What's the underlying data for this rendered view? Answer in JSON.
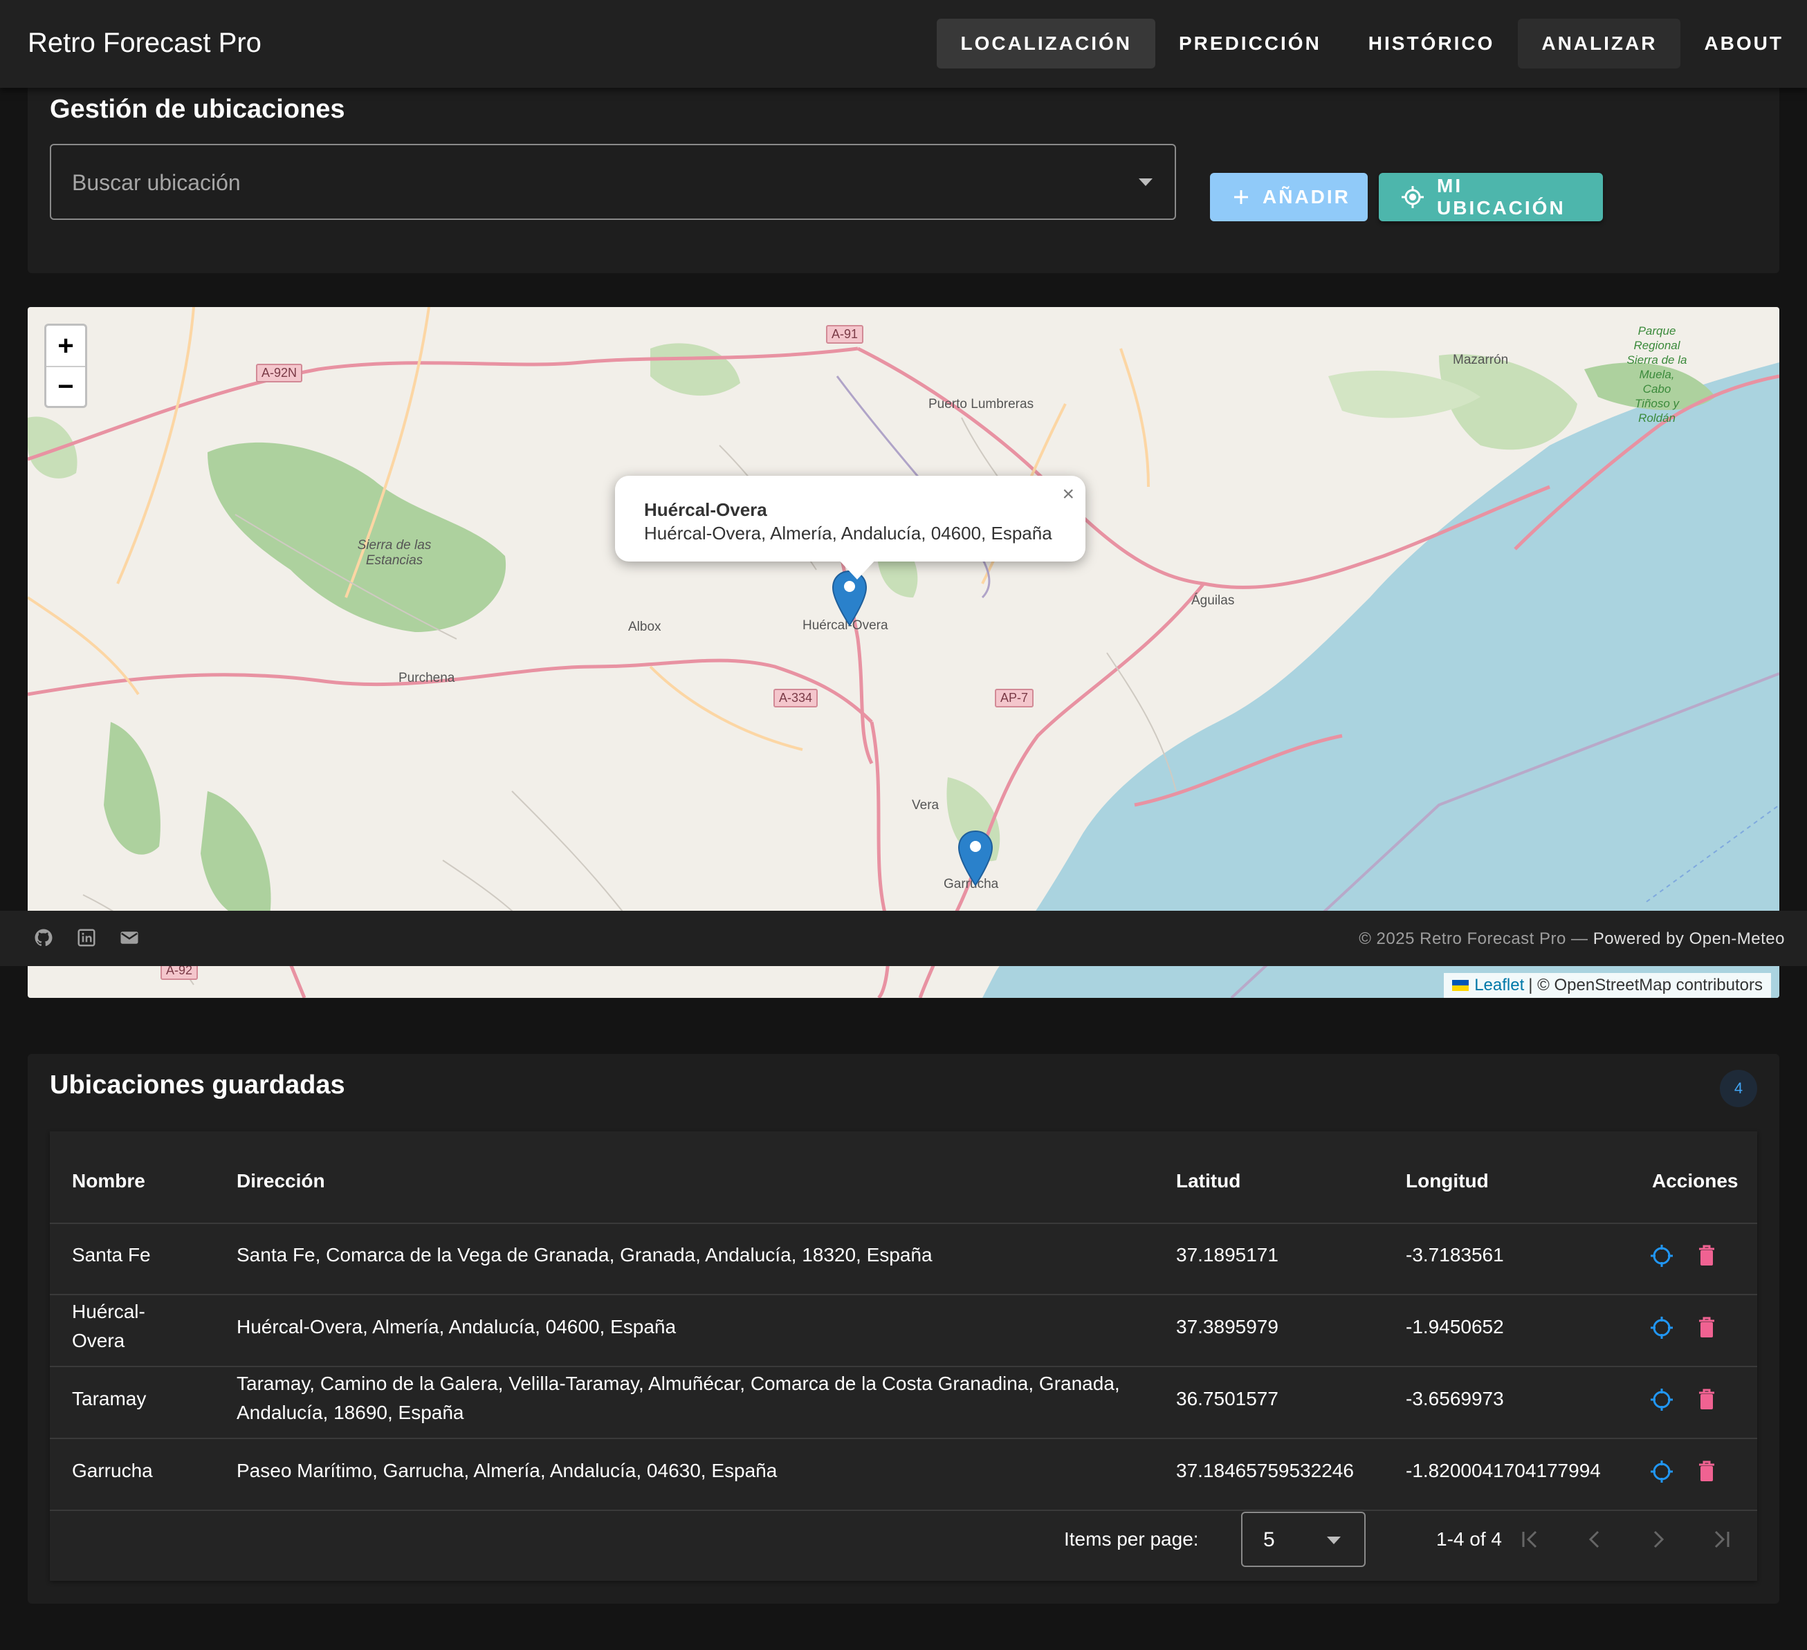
{
  "app": {
    "title": "Retro Forecast Pro"
  },
  "nav": {
    "items": [
      {
        "label": "LOCALIZACIÓN"
      },
      {
        "label": "PREDICCIÓN"
      },
      {
        "label": "HISTÓRICO"
      },
      {
        "label": "ANALIZAR"
      },
      {
        "label": "ABOUT"
      }
    ]
  },
  "manage": {
    "title": "Gestión de ubicaciones",
    "search_placeholder": "Buscar ubicación",
    "add_label": "AÑADIR",
    "my_location_label": "MI UBICACIÓN"
  },
  "map": {
    "zoom_in": "+",
    "zoom_out": "−",
    "popup": {
      "title": "Huércal-Overa",
      "address": "Huércal-Overa, Almería, Andalucía, 04600, España",
      "close": "×"
    },
    "labels": {
      "mazarron": "Mazarrón",
      "puerto_lumbreras": "Puerto Lumbreras",
      "parque": "Parque Regional Sierra de la Muela, Cabo Tiñoso y Roldán",
      "sierra": "Sierra de las Estancias",
      "aguilas": "Águilas",
      "albox": "Albox",
      "huercal": "Huércal-Overa",
      "purchena": "Purchena",
      "vera": "Vera",
      "garrucha": "Garrucha",
      "a91": "A-91",
      "a92n": "A-92N",
      "a334": "A-334",
      "ap7": "AP-7",
      "a92": "A-92"
    },
    "attribution": {
      "leaflet": "Leaflet",
      "rest": "| © OpenStreetMap contributors"
    },
    "colors": {
      "land": "#f2efe9",
      "sea": "#aad3df",
      "forest": "#add19e",
      "road": "#e892a2"
    }
  },
  "footer": {
    "icons": [
      "github-icon",
      "linkedin-icon",
      "mail-icon"
    ],
    "copyright": "© 2025 Retro Forecast Pro — ",
    "powered": "Powered by Open-Meteo"
  },
  "saved": {
    "title": "Ubicaciones guardadas",
    "count": "4",
    "columns": [
      "Nombre",
      "Dirección",
      "Latitud",
      "Longitud",
      "Acciones"
    ],
    "rows": [
      {
        "name": "Santa Fe",
        "address": "Santa Fe, Comarca de la Vega de Granada, Granada, Andalucía, 18320, España",
        "lat": "37.1895171",
        "lon": "-3.7183561"
      },
      {
        "name": "Huércal-Overa",
        "address": "Huércal-Overa, Almería, Andalucía, 04600, España",
        "lat": "37.3895979",
        "lon": "-1.9450652"
      },
      {
        "name": "Taramay",
        "address": "Taramay, Camino de la Galera, Velilla-Taramay, Almuñécar, Comarca de la Costa Granadina, Granada, Andalucía, 18690, España",
        "lat": "36.7501577",
        "lon": "-3.6569973"
      },
      {
        "name": "Garrucha",
        "address": "Paseo Marítimo, Garrucha, Almería, Andalucía, 04630, España",
        "lat": "37.18465759532246",
        "lon": "-1.8200041704177994"
      }
    ],
    "pagination": {
      "items_per_page_label": "Items per page:",
      "items_per_page_value": "5",
      "range": "1-4 of 4"
    },
    "colors": {
      "locate": "#2196f3",
      "delete": "#f06292"
    }
  }
}
